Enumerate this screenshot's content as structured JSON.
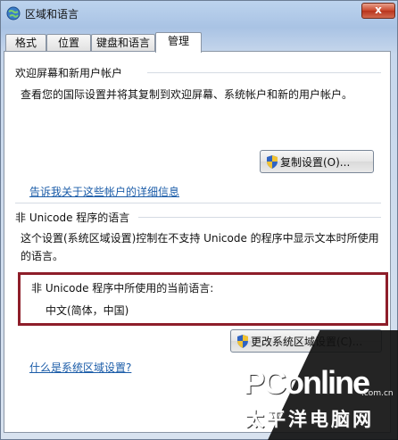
{
  "window": {
    "title": "区域和语言",
    "close_label": "x"
  },
  "tabs": [
    {
      "label": "格式"
    },
    {
      "label": "位置"
    },
    {
      "label": "键盘和语言"
    },
    {
      "label": "管理"
    }
  ],
  "welcome_group": {
    "title": "欢迎屏幕和新用户帐户",
    "description": "查看您的国际设置并将其复制到欢迎屏幕、系统帐户和新的用户帐户。",
    "copy_button": "复制设置(O)...",
    "details_link": "告诉我关于这些帐户的详细信息"
  },
  "unicode_group": {
    "title": "非 Unicode 程序的语言",
    "description": "这个设置(系统区域设置)控制在不支持 Unicode 的程序中显示文本时所使用的语言。",
    "current_label": "非 Unicode 程序中所使用的当前语言:",
    "current_value": "中文(简体，中国)",
    "change_button": "更改系统区域设置(C)...",
    "what_link": "什么是系统区域设置?"
  },
  "watermark": {
    "logo": "PConline",
    "subtitle": "太平洋电脑网",
    "domain": ".com.cn"
  }
}
